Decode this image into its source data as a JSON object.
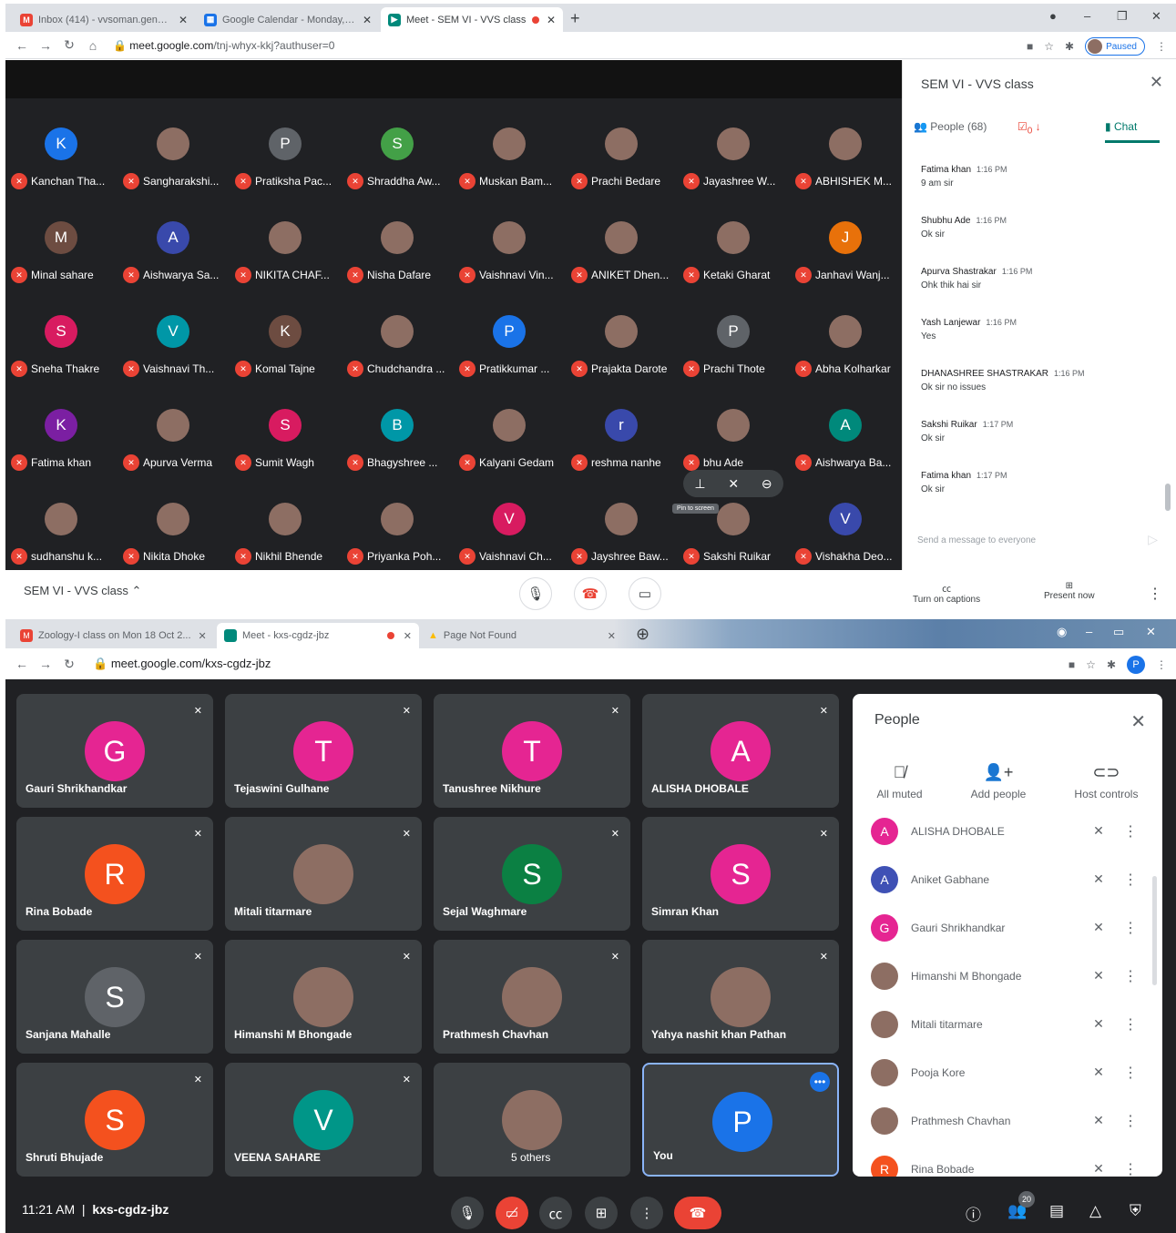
{
  "s1": {
    "tabs": [
      {
        "label": "Inbox (414) - vvsoman.gen@gm..."
      },
      {
        "label": "Google Calendar - Monday, Apri..."
      },
      {
        "label": "Meet - SEM VI - VVS class"
      }
    ],
    "url_host": "meet.google.com",
    "url_path": "/tnj-whyx-kkj?authuser=0",
    "paused": "Paused",
    "participants": [
      [
        "K",
        "Kanchan Tha..."
      ],
      [
        "",
        "Sangharakshi..."
      ],
      [
        "P",
        "Pratiksha Pac..."
      ],
      [
        "S",
        "Shraddha Aw..."
      ],
      [
        "",
        "Muskan Bam..."
      ],
      [
        "",
        "Prachi Bedare"
      ],
      [
        "",
        "Jayashree W..."
      ],
      [
        "",
        "ABHISHEK M..."
      ],
      [
        "M",
        "Minal sahare"
      ],
      [
        "A",
        "Aishwarya Sa..."
      ],
      [
        "",
        "NIKITA CHAF..."
      ],
      [
        "",
        "Nisha Dafare"
      ],
      [
        "",
        "Vaishnavi Vin..."
      ],
      [
        "",
        "ANIKET Dhen..."
      ],
      [
        "",
        "Ketaki Gharat"
      ],
      [
        "J",
        "Janhavi Wanj..."
      ],
      [
        "S",
        "Sneha Thakre"
      ],
      [
        "V",
        "Vaishnavi Th..."
      ],
      [
        "K",
        "Komal Tajne"
      ],
      [
        "",
        "Chudchandra ..."
      ],
      [
        "P",
        "Pratikkumar ..."
      ],
      [
        "",
        "Prajakta Darote"
      ],
      [
        "P",
        "Prachi Thote"
      ],
      [
        "",
        "Abha Kolharkar"
      ],
      [
        "K",
        "Fatima khan"
      ],
      [
        "",
        "Apurva Verma"
      ],
      [
        "S",
        "Sumit Wagh"
      ],
      [
        "B",
        "Bhagyshree ..."
      ],
      [
        "",
        "Kalyani Gedam"
      ],
      [
        "r",
        "reshma nanhe"
      ],
      [
        "",
        "bhu Ade"
      ],
      [
        "A",
        "Aishwarya Ba..."
      ],
      [
        "",
        "sudhanshu k..."
      ],
      [
        "",
        "Nikita Dhoke"
      ],
      [
        "",
        "Nikhil Bhende"
      ],
      [
        "",
        "Priyanka Poh..."
      ],
      [
        "V",
        "Vaishnavi Ch..."
      ],
      [
        "",
        "Jayshree Baw..."
      ],
      [
        "",
        "Sakshi Ruikar"
      ],
      [
        "V",
        "Vishakha Deo..."
      ]
    ],
    "pin_label": "Pin to screen",
    "side": {
      "title": "SEM VI - VVS class",
      "people": "People (68)",
      "tasks": "0",
      "chat": "Chat",
      "messages": [
        {
          "name": "Fatima khan",
          "time": "1:16 PM",
          "text": "9 am sir"
        },
        {
          "name": "Shubhu Ade",
          "time": "1:16 PM",
          "text": "Ok sir"
        },
        {
          "name": "Apurva Shastrakar",
          "time": "1:16 PM",
          "text": "Ohk thik hai sir"
        },
        {
          "name": "Yash Lanjewar",
          "time": "1:16 PM",
          "text": "Yes"
        },
        {
          "name": "DHANASHREE SHASTRAKAR",
          "time": "1:16 PM",
          "text": "Ok sir no issues"
        },
        {
          "name": "Sakshi Ruikar",
          "time": "1:17 PM",
          "text": "Ok sir"
        },
        {
          "name": "Fatima khan",
          "time": "1:17 PM",
          "text": "Ok sir"
        }
      ],
      "send_placeholder": "Send a message to everyone"
    },
    "bottom": {
      "meeting": "SEM VI - VVS class",
      "captions": "Turn on captions",
      "present": "Present now"
    }
  },
  "s2": {
    "tabs": [
      {
        "label": "Zoology-I class on Mon 18 Oct 2..."
      },
      {
        "label": "Meet - kxs-cgdz-jbz"
      },
      {
        "label": "Page Not Found"
      }
    ],
    "url": "meet.google.com/kxs-cgdz-jbz",
    "tiles": [
      [
        "G",
        "Gauri Shrikhandkar"
      ],
      [
        "T",
        "Tejaswini Gulhane"
      ],
      [
        "T",
        "Tanushree Nikhure"
      ],
      [
        "A",
        "ALISHA DHOBALE"
      ],
      [
        "R",
        "Rina Bobade"
      ],
      [
        "",
        "Mitali titarmare"
      ],
      [
        "S",
        "Sejal Waghmare"
      ],
      [
        "S",
        "Simran Khan"
      ],
      [
        "S",
        "Sanjana Mahalle"
      ],
      [
        "",
        "Himanshi M Bhongade"
      ],
      [
        "",
        "Prathmesh Chavhan"
      ],
      [
        "",
        "Yahya nashit khan Pathan"
      ],
      [
        "S",
        "Shruti Bhujade"
      ],
      [
        "V",
        "VEENA SAHARE"
      ],
      [
        "",
        "5 others"
      ],
      [
        "P",
        "You"
      ]
    ],
    "panel": {
      "title": "People",
      "all_muted": "All muted",
      "add_people": "Add people",
      "host_controls": "Host controls",
      "list": [
        [
          "A",
          "ALISHA DHOBALE"
        ],
        [
          "A",
          "Aniket Gabhane"
        ],
        [
          "G",
          "Gauri Shrikhandkar"
        ],
        [
          "",
          "Himanshi M Bhongade"
        ],
        [
          "",
          "Mitali titarmare"
        ],
        [
          "",
          "Pooja Kore"
        ],
        [
          "",
          "Prathmesh Chavhan"
        ],
        [
          "R",
          "Rina Bobade"
        ]
      ]
    },
    "bottom": {
      "time": "11:21 AM",
      "code": "kxs-cgdz-jbz",
      "count": "20"
    }
  }
}
